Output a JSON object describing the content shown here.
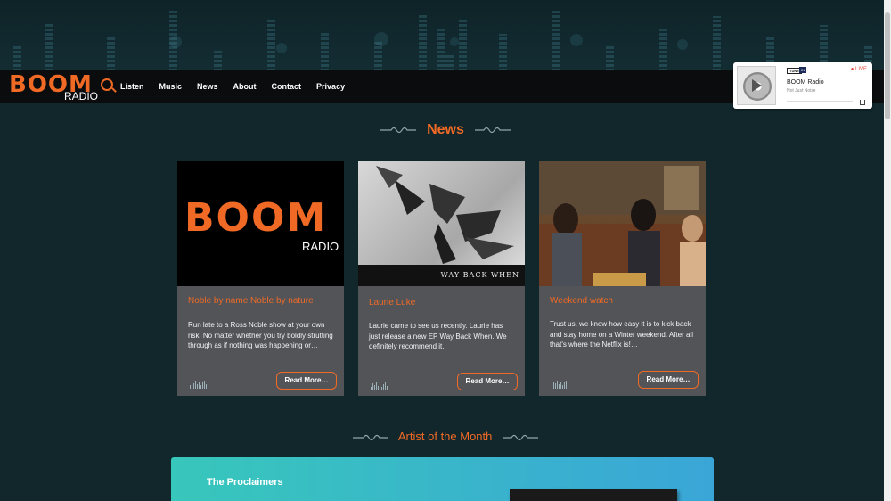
{
  "site": {
    "logo_main": "BOOM",
    "logo_sub": "RADIO"
  },
  "nav": {
    "items": [
      "Listen",
      "Music",
      "News",
      "About",
      "Contact",
      "Privacy"
    ]
  },
  "player": {
    "brand": "TUNE",
    "brand_badge": "IN",
    "live_label": "● LIVE",
    "title": "BOOM Radio",
    "subtitle": "Not Just Noise"
  },
  "news": {
    "heading": "News",
    "cards": [
      {
        "title": "Noble by name Noble by nature",
        "excerpt": "Run late to a Ross Noble show at your own risk. No matter whether you try boldly strutting through as if nothing was happening or…",
        "button": "Read More…",
        "image_logo_main": "BOOM",
        "image_logo_sub": "RADIO"
      },
      {
        "title": "Laurie Luke",
        "excerpt": "Laurie came to see us recently. Laurie has just release a new EP Way Back When. We definitely recommend it.",
        "button": "Read More…",
        "image_caption": "WAY BACK WHEN"
      },
      {
        "title": "Weekend watch",
        "excerpt": "Trust us, we know how easy it is to kick back and stay home on a Winter weekend. After all that's where the Netflix is!…",
        "button": "Read More…"
      }
    ]
  },
  "artist": {
    "heading": "Artist of the Month",
    "name": "The Proclaimers"
  },
  "colors": {
    "accent": "#f06a25",
    "background": "#11272c",
    "card": "#525458",
    "nav": "#0a0c0d"
  }
}
